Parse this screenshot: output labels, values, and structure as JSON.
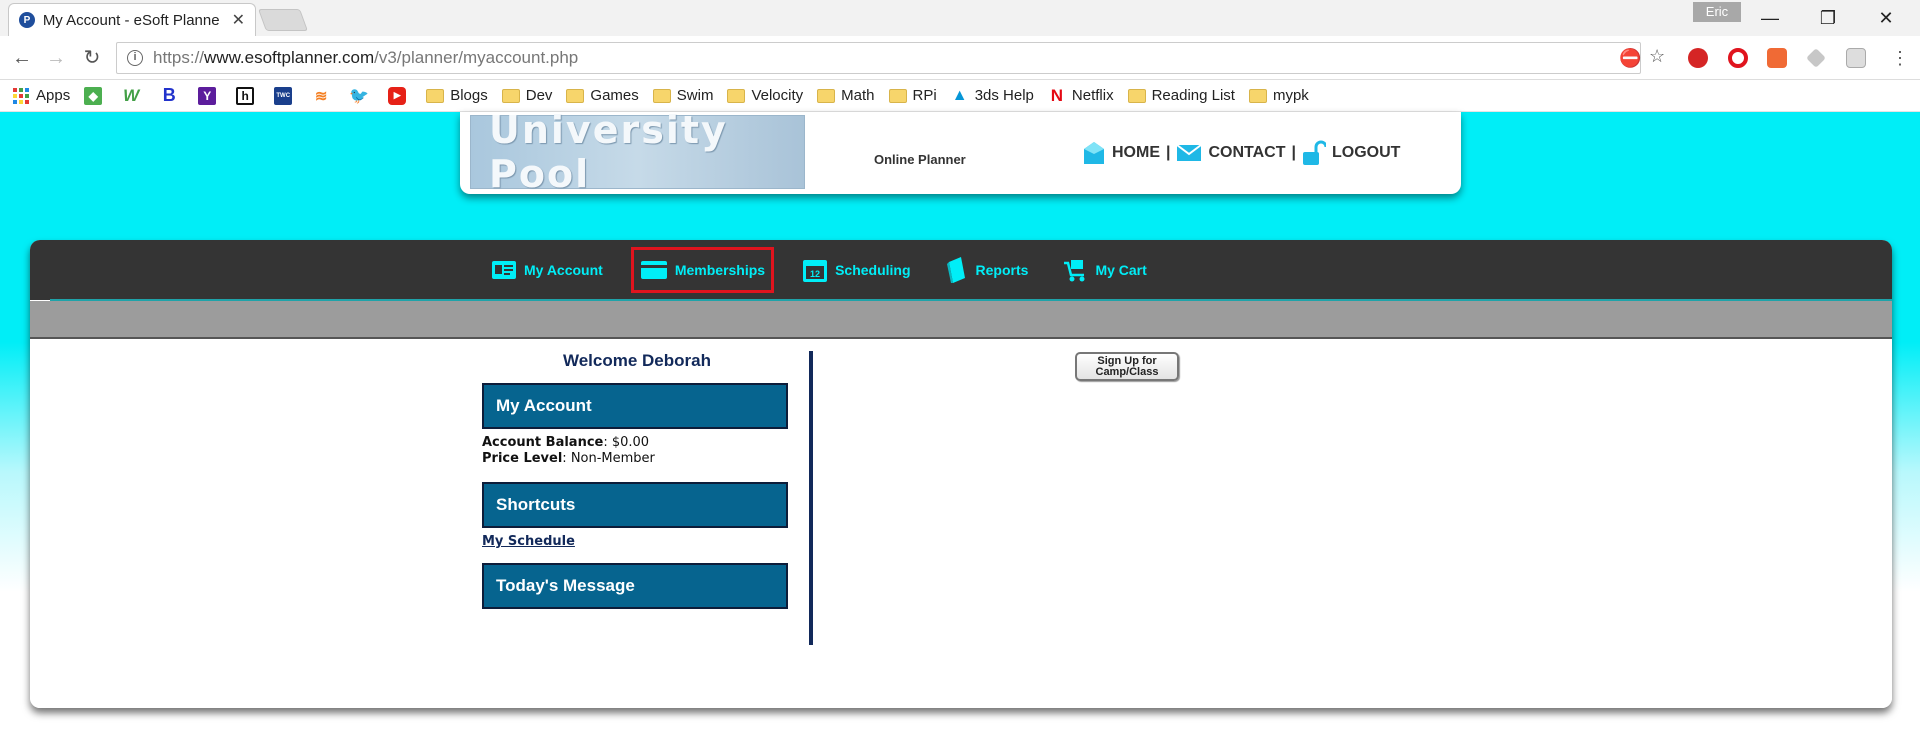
{
  "browser": {
    "tab_title": "My Account - eSoft Planne",
    "profile_name": "Eric",
    "url_prefix": "https://",
    "url_host": "www.esoftplanner.com",
    "url_path": "/v3/planner/myaccount.php",
    "bookmarks": [
      {
        "label": "Apps",
        "icon": "apps-grid-icon"
      },
      {
        "label": "",
        "icon": "google-maps-icon"
      },
      {
        "label": "",
        "icon": "w-icon"
      },
      {
        "label": "",
        "icon": "b-icon"
      },
      {
        "label": "",
        "icon": "yahoo-icon"
      },
      {
        "label": "",
        "icon": "h-icon"
      },
      {
        "label": "",
        "icon": "weather-channel-icon"
      },
      {
        "label": "",
        "icon": "stack-icon"
      },
      {
        "label": "",
        "icon": "twitter-icon"
      },
      {
        "label": "",
        "icon": "youtube-icon"
      },
      {
        "label": "Blogs",
        "icon": "folder-icon"
      },
      {
        "label": "Dev",
        "icon": "folder-icon"
      },
      {
        "label": "Games",
        "icon": "folder-icon"
      },
      {
        "label": "Swim",
        "icon": "folder-icon"
      },
      {
        "label": "Velocity",
        "icon": "folder-icon"
      },
      {
        "label": "Math",
        "icon": "folder-icon"
      },
      {
        "label": "RPi",
        "icon": "folder-icon"
      },
      {
        "label": "3ds Help",
        "icon": "autodesk-icon"
      },
      {
        "label": "Netflix",
        "icon": "netflix-icon"
      },
      {
        "label": "Reading List",
        "icon": "folder-icon"
      },
      {
        "label": "mypk",
        "icon": "folder-icon"
      }
    ]
  },
  "header": {
    "logo_text": "University Pool",
    "subtitle": "Online Planner",
    "links": {
      "home": "HOME",
      "contact": "CONTACT",
      "logout": "LOGOUT",
      "separator": "|"
    }
  },
  "nav": {
    "items": [
      {
        "label": "My Account",
        "icon": "id-card-icon"
      },
      {
        "label": "Memberships",
        "icon": "credit-card-icon"
      },
      {
        "label": "Scheduling",
        "icon": "calendar-icon",
        "badge": "12"
      },
      {
        "label": "Reports",
        "icon": "book-icon"
      },
      {
        "label": "My Cart",
        "icon": "cart-icon"
      }
    ],
    "highlighted": "Memberships"
  },
  "sidebar": {
    "welcome": "Welcome Deborah",
    "my_account_heading": "My Account",
    "balance_label": "Account Balance",
    "balance_value": "$0.00",
    "price_level_label": "Price Level",
    "price_level_value": "Non-Member",
    "shortcuts_heading": "Shortcuts",
    "my_schedule_link": "My Schedule",
    "todays_message_heading": "Today's Message"
  },
  "main": {
    "signup_line1": "Sign Up for",
    "signup_line2": "Camp/Class"
  },
  "colors": {
    "page_bg": "#00eef7",
    "nav_bg": "#343434",
    "nav_text": "#00eef7",
    "panel_head": "#06648f",
    "highlight": "#e0141e"
  }
}
